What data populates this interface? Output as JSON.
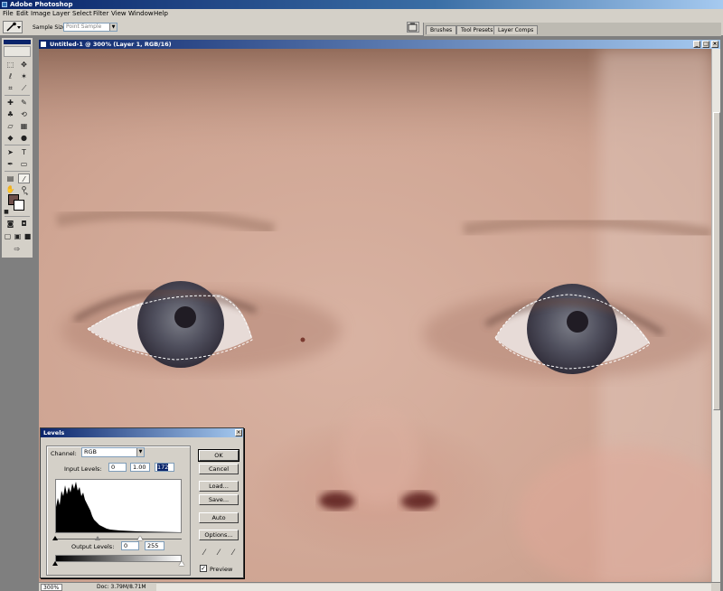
{
  "app": {
    "title": "Adobe Photoshop"
  },
  "menu": [
    "File",
    "Edit",
    "Image",
    "Layer",
    "Select",
    "Filter",
    "View",
    "Window",
    "Help"
  ],
  "options_bar": {
    "sample_size_label": "Sample Size:",
    "sample_size_value": "Point Sample",
    "palette_tabs": [
      "Brushes",
      "Tool Presets",
      "Layer Comps"
    ]
  },
  "document": {
    "title": "Untitled-1 @ 300% (Layer 1, RGB/16)",
    "zoom": "300%",
    "doc_info": "Doc: 3.79M/8.71M",
    "image_colors": {
      "skin": "#cfa593",
      "iris": "#50505e",
      "brow": "#9a7565",
      "nostril": "#6a2f2a"
    }
  },
  "levels": {
    "title": "Levels",
    "channel_label": "Channel:",
    "channel_value": "RGB",
    "input_levels_label": "Input Levels:",
    "input_black": "0",
    "input_gamma": "1.00",
    "input_white": "172",
    "output_levels_label": "Output Levels:",
    "output_black": "0",
    "output_white": "255",
    "buttons": {
      "ok": "OK",
      "cancel": "Cancel",
      "load": "Load...",
      "save": "Save...",
      "auto": "Auto",
      "options": "Options..."
    },
    "preview_label": "Preview",
    "preview_checked": true,
    "input_slider_positions": {
      "black": 0,
      "gamma": 0.5,
      "white": 0.67
    },
    "output_slider_positions": {
      "black": 0,
      "white": 1
    }
  },
  "toolbox": {
    "foreground_color": "#6e4f4b",
    "background_color": "#ffffff"
  }
}
